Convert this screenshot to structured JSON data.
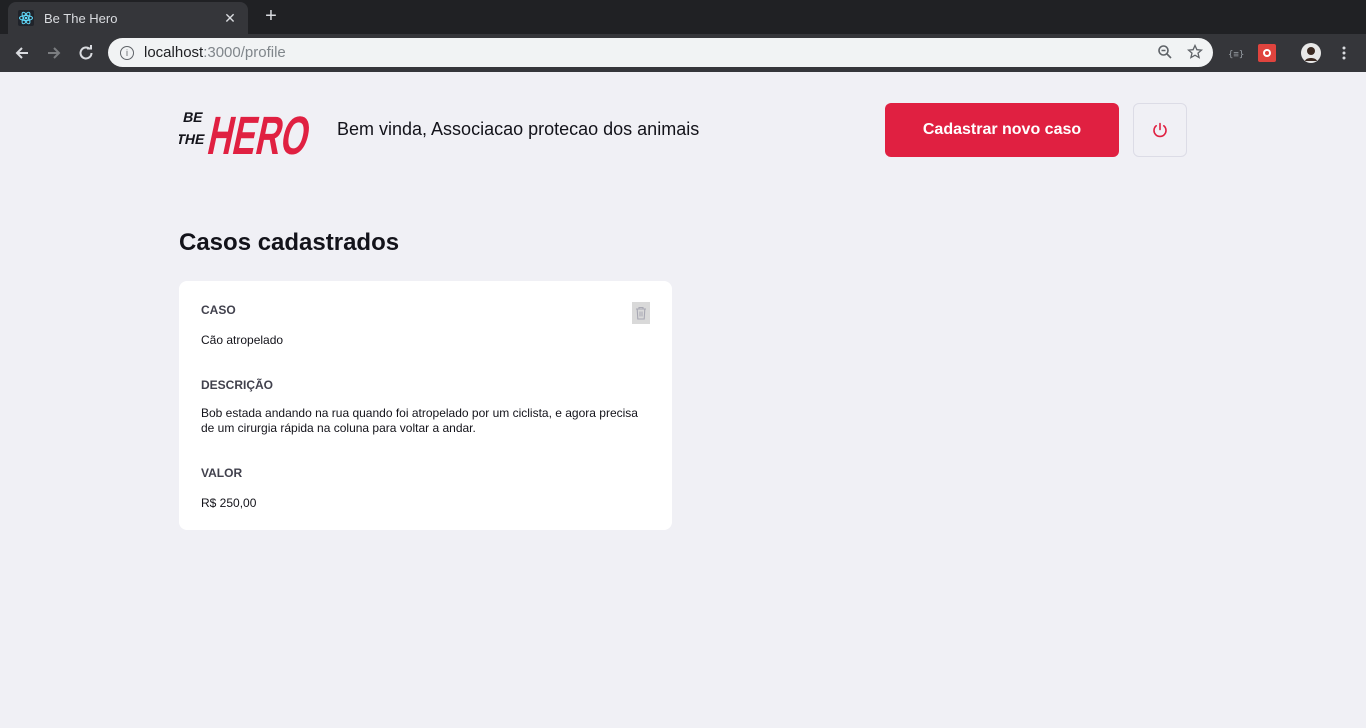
{
  "browser": {
    "tab_title": "Be The Hero",
    "tab_close": "✕",
    "new_tab": "+",
    "url_host": "localhost",
    "url_path": ":3000/profile"
  },
  "header": {
    "logo_line1": "BE",
    "logo_line2": "THE",
    "logo_word": "HERO",
    "welcome": "Bem vinda, Associacao protecao dos animais",
    "new_case_button": "Cadastrar novo caso"
  },
  "main": {
    "section_title": "Casos cadastrados",
    "cases": [
      {
        "case_label": "CASO",
        "case_value": "Cão atropelado",
        "description_label": "DESCRIÇÃO",
        "description_value": "Bob estada andando na rua quando foi atropelado por um ciclista, e agora precisa de um cirurgia rápida na coluna para voltar a andar.",
        "value_label": "VALOR",
        "value_value": "R$ 250,00"
      }
    ]
  },
  "colors": {
    "accent": "#e02041",
    "background": "#f0f0f5",
    "card": "#ffffff"
  }
}
